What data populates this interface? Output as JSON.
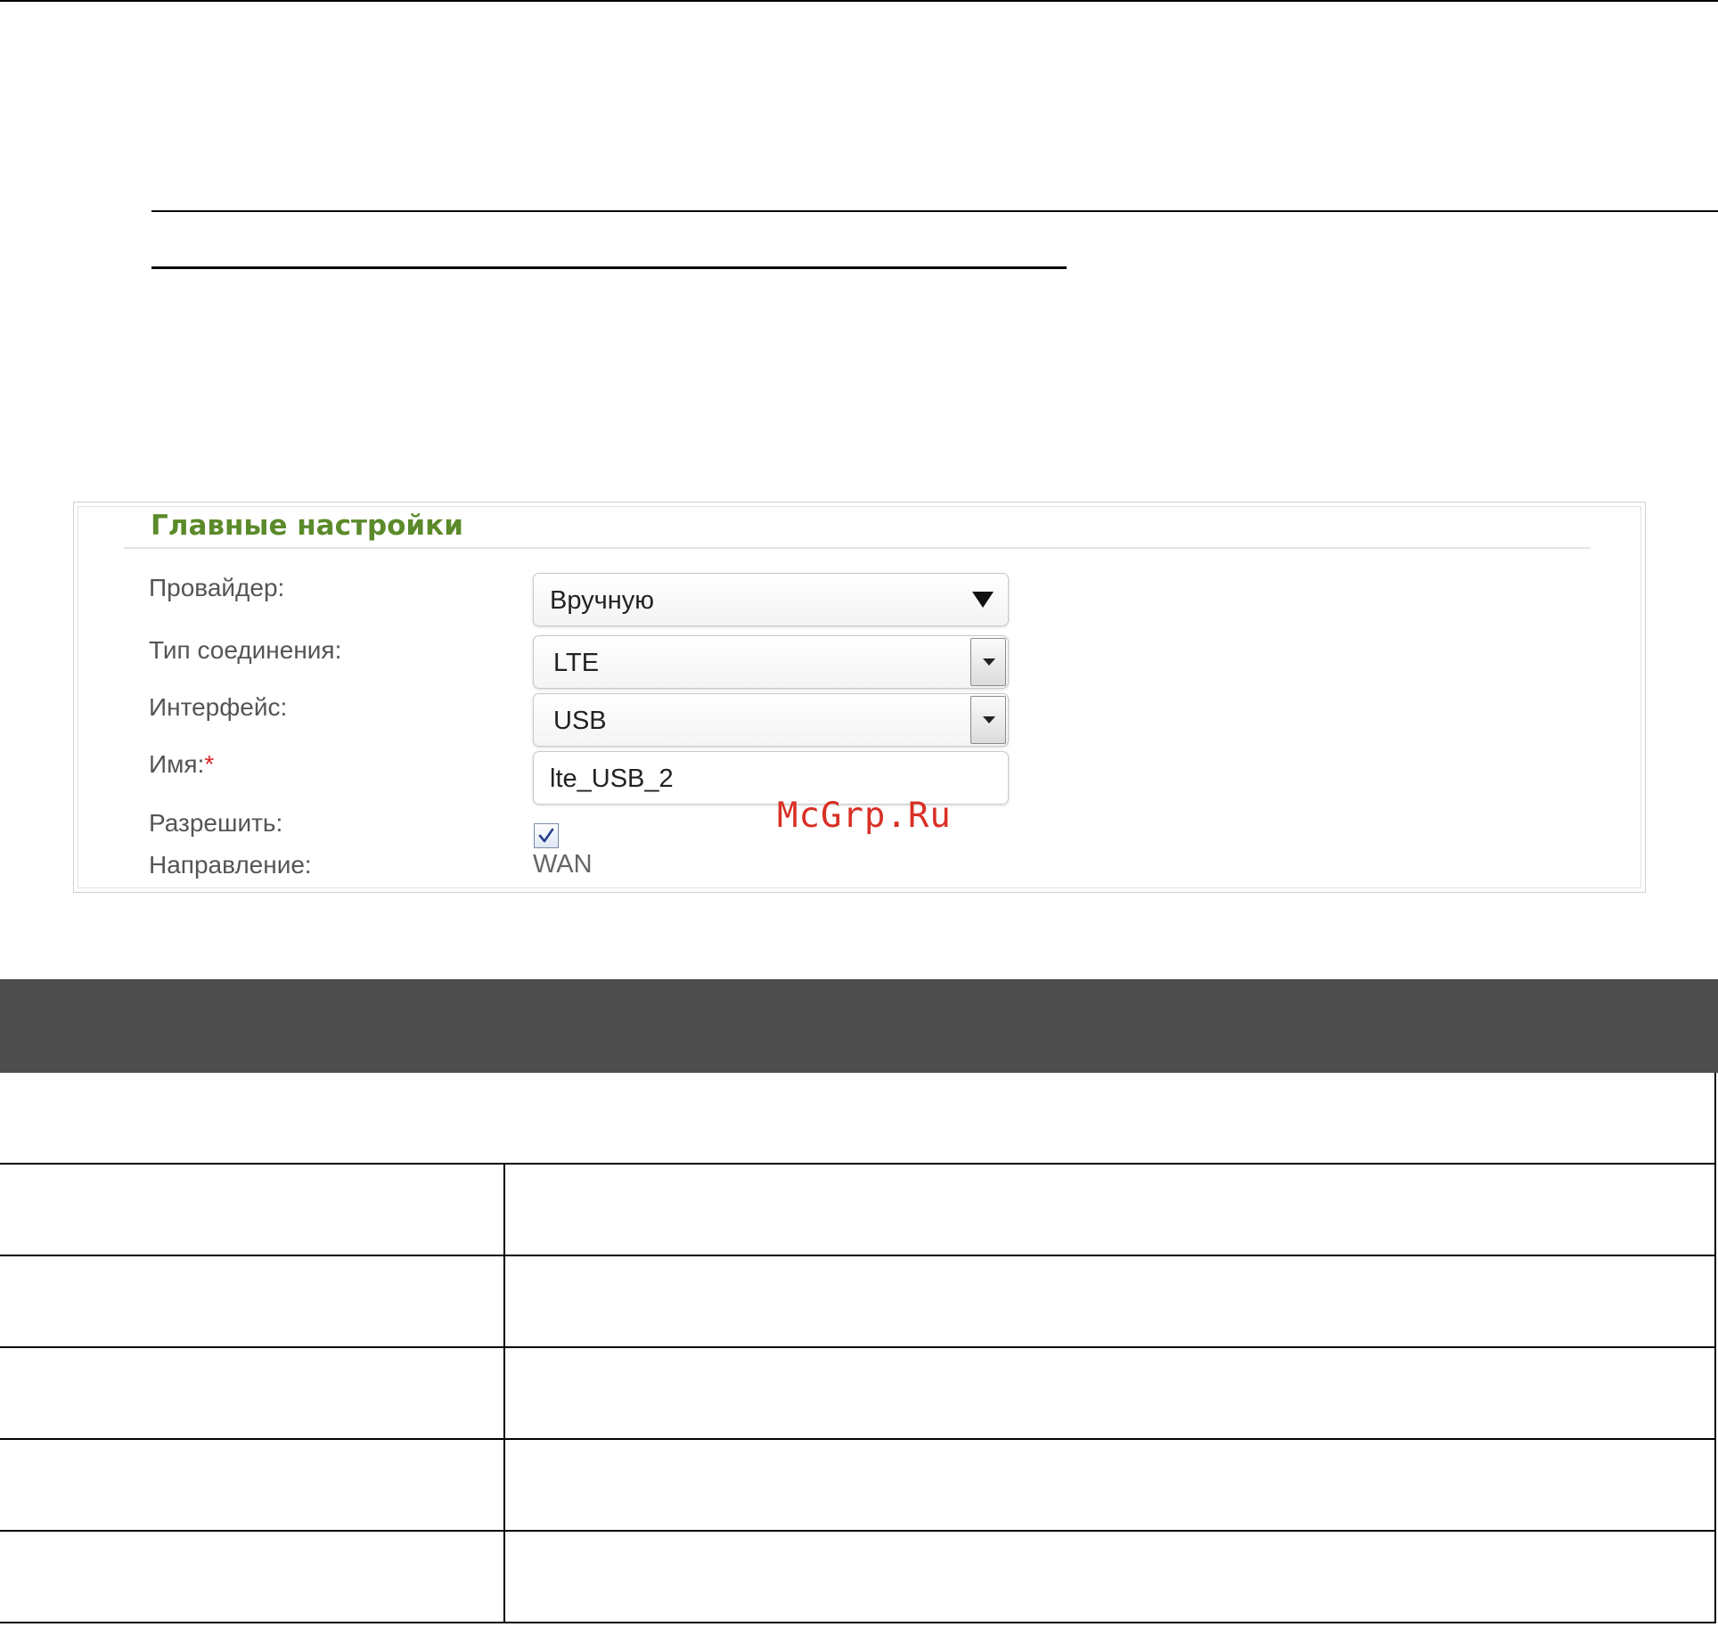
{
  "main_settings": {
    "title": "Главные настройки",
    "provider": {
      "label": "Провайдер:",
      "value": "Вручную"
    },
    "connection_type": {
      "label": "Тип соединения:",
      "value": "LTE"
    },
    "interface": {
      "label": "Интерфейс:",
      "value": "USB"
    },
    "name": {
      "label": "Имя:",
      "required_mark": "*",
      "value": "lte_USB_2"
    },
    "enable": {
      "label": "Разрешить:",
      "checked": true
    },
    "direction": {
      "label": "Направление:",
      "value": "WAN"
    }
  },
  "watermark": "McGrp.Ru",
  "colors": {
    "title_green": "#5b8a2a",
    "table_header": "#4d4d4d",
    "required_red": "#d9232a",
    "watermark_red": "#d93025"
  }
}
